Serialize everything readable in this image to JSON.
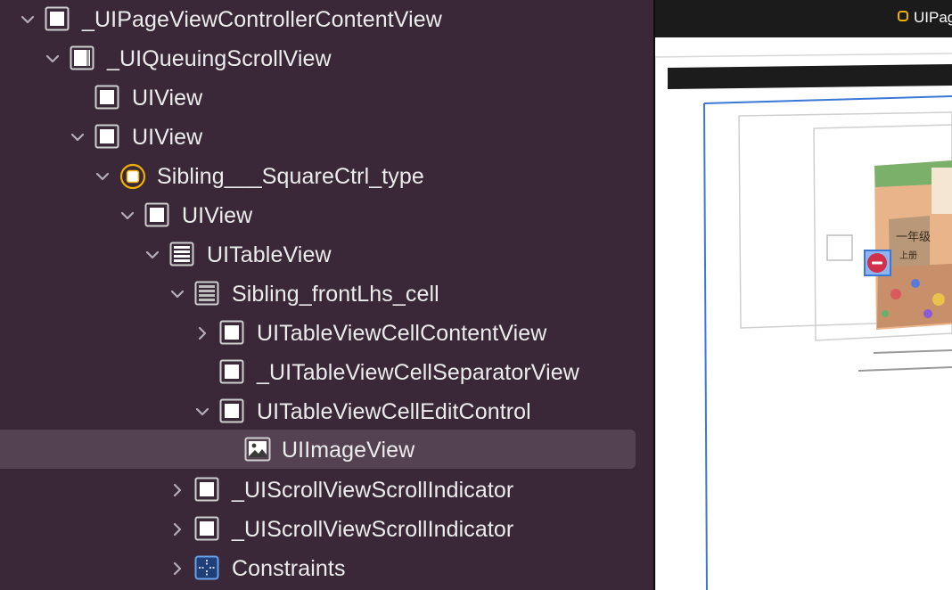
{
  "outline": {
    "items": [
      {
        "label": "_UIPageViewControllerContentView",
        "icon": "view-icon",
        "disclosure": "expanded"
      },
      {
        "label": "_UIQueuingScrollView",
        "icon": "scroll-view-icon",
        "disclosure": "expanded"
      },
      {
        "label": "UIView",
        "icon": "view-icon",
        "disclosure": "none"
      },
      {
        "label": "UIView",
        "icon": "view-icon",
        "disclosure": "expanded"
      },
      {
        "label": "Sibling___SquareCtrl_type",
        "icon": "view-controller-icon",
        "disclosure": "expanded"
      },
      {
        "label": "UIView",
        "icon": "view-icon",
        "disclosure": "expanded"
      },
      {
        "label": "UITableView",
        "icon": "table-view-icon",
        "disclosure": "expanded"
      },
      {
        "label": "Sibling_frontLhs_cell",
        "icon": "table-cell-icon",
        "disclosure": "expanded"
      },
      {
        "label": "UITableViewCellContentView",
        "icon": "view-icon",
        "disclosure": "collapsed"
      },
      {
        "label": "_UITableViewCellSeparatorView",
        "icon": "view-icon",
        "disclosure": "none"
      },
      {
        "label": "UITableViewCellEditControl",
        "icon": "view-icon",
        "disclosure": "expanded"
      },
      {
        "label": "UIImageView",
        "icon": "image-view-icon",
        "disclosure": "none",
        "selected": true
      },
      {
        "label": "_UIScrollViewScrollIndicator",
        "icon": "view-icon",
        "disclosure": "collapsed"
      },
      {
        "label": "_UIScrollViewScrollIndicator",
        "icon": "view-icon",
        "disclosure": "collapsed"
      },
      {
        "label": "Constraints",
        "icon": "constraints-icon",
        "disclosure": "collapsed"
      }
    ]
  },
  "canvas": {
    "tab_label": "UIPageV",
    "book": {
      "grade_text": "一年级",
      "volume_text": "上册"
    }
  },
  "colors": {
    "background": "#3a2838",
    "selection": "#544253",
    "text": "#ececec",
    "canvas_selection": "#3a78d8",
    "delete_control": "#d0304a"
  }
}
